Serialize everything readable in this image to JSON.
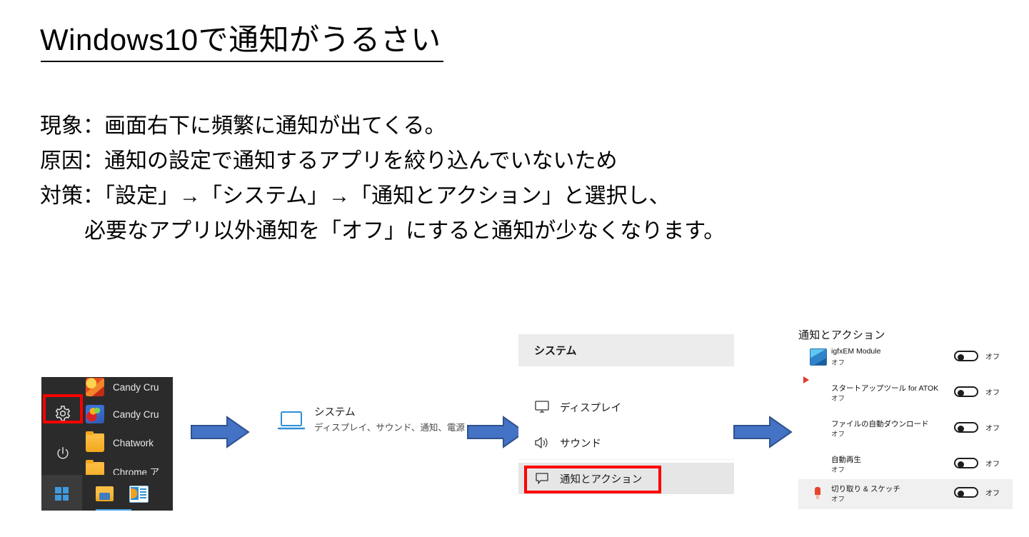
{
  "slide": {
    "headline": "Windows10で通知がうるさい",
    "body_lines": [
      {
        "text": "現象：画面右下に頻繁に通知が出てくる。",
        "indent": false
      },
      {
        "text": "原因：通知の設定で通知するアプリを絞り込んでいないため",
        "indent": false
      },
      {
        "text": "対策：「設定」→「システム」→「通知とアクション」と選択し、",
        "indent": false
      },
      {
        "text": "必要なアプリ以外通知を「オフ」にすると通知が少なくなります。",
        "indent": true
      }
    ]
  },
  "start_menu": {
    "gear_icon": "gear-icon",
    "power_icon": "power-icon",
    "items": [
      {
        "label": "Candy Cru",
        "icon": "candy-crush-friends-icon"
      },
      {
        "label": "Candy Cru",
        "icon": "candy-crush-saga-icon"
      },
      {
        "label": "Chatwork",
        "icon": "folder-icon"
      },
      {
        "label": "Chrome ア",
        "icon": "folder-icon"
      }
    ],
    "taskbar": {
      "start_icon": "windows-logo-icon",
      "explorer_icon": "file-explorer-icon",
      "office_icon": "office-icon"
    }
  },
  "system_shortcut": {
    "icon": "laptop-icon",
    "title": "システム",
    "subtitle": "ディスプレイ、サウンド、通知、電源"
  },
  "system_panel": {
    "header": "システム",
    "items": [
      {
        "label": "ディスプレイ",
        "icon": "display-icon",
        "highlighted": false
      },
      {
        "label": "サウンド",
        "icon": "speaker-icon",
        "highlighted": false
      },
      {
        "label": "通知とアクション",
        "icon": "notification-balloon-icon",
        "highlighted": true
      }
    ]
  },
  "notifications_panel": {
    "title": "通知とアクション",
    "rows": [
      {
        "name": "igfxEM Module",
        "state": "オフ",
        "toggle_label": "オフ",
        "icon": "igfx-module-icon",
        "highlighted": false
      },
      {
        "name": "スタートアップツール for ATOK",
        "state": "オフ",
        "toggle_label": "オフ",
        "icon": "atok-startup-icon",
        "highlighted": false
      },
      {
        "name": "ファイルの自動ダウンロード",
        "state": "オフ",
        "toggle_label": "オフ",
        "icon": "onedrive-cloud-icon",
        "highlighted": false
      },
      {
        "name": "自動再生",
        "state": "オフ",
        "toggle_label": "オフ",
        "icon": "autoplay-icon",
        "highlighted": false
      },
      {
        "name": "切り取り & スケッチ",
        "state": "オフ",
        "toggle_label": "オフ",
        "icon": "snip-sketch-icon",
        "highlighted": true
      }
    ]
  },
  "flow": {
    "arrows": [
      {
        "name": "arrow-1"
      },
      {
        "name": "arrow-2"
      },
      {
        "name": "arrow-3"
      }
    ],
    "arrow_color": "#4472c4",
    "arrow_outline": "#2f528f"
  },
  "colors": {
    "highlight_box": "#ff0000",
    "start_menu_bg": "#2b2b2b",
    "panel_header_bg": "#ececec"
  }
}
